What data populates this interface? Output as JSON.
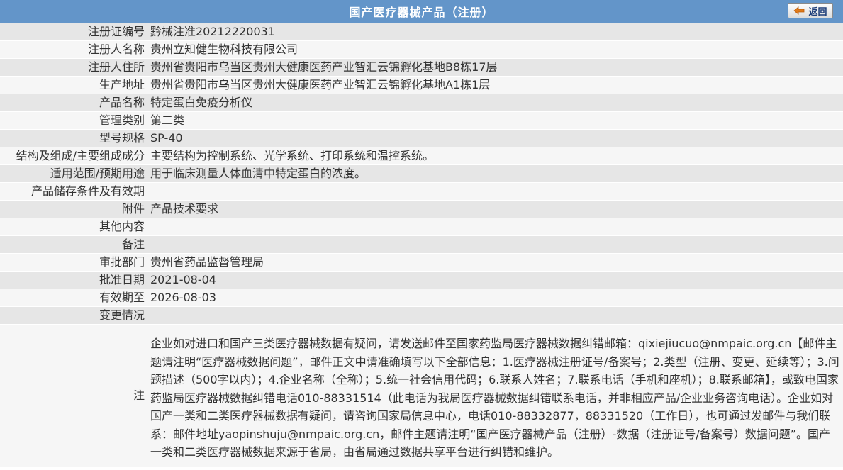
{
  "header": {
    "title": "国产医疗器械产品（注册）",
    "back_label": "返回"
  },
  "rows": [
    {
      "label": "注册证编号",
      "value": "黔械注准20212220031"
    },
    {
      "label": "注册人名称",
      "value": "贵州立知健生物科技有限公司"
    },
    {
      "label": "注册人住所",
      "value": "贵州省贵阳市乌当区贵州大健康医药产业智汇云锦孵化基地B8栋17层"
    },
    {
      "label": "生产地址",
      "value": "贵州省贵阳市乌当区贵州大健康医药产业智汇云锦孵化基地A1栋1层"
    },
    {
      "label": "产品名称",
      "value": "特定蛋白免疫分析仪"
    },
    {
      "label": "管理类别",
      "value": "第二类"
    },
    {
      "label": "型号规格",
      "value": "SP-40"
    },
    {
      "label": "结构及组成/主要组成成分",
      "value": "主要结构为控制系统、光学系统、打印系统和温控系统。"
    },
    {
      "label": "适用范围/预期用途",
      "value": "用于临床测量人体血清中特定蛋白的浓度。"
    },
    {
      "label": "产品储存条件及有效期",
      "value": ""
    },
    {
      "label": "附件",
      "value": "产品技术要求"
    },
    {
      "label": "其他内容",
      "value": ""
    },
    {
      "label": "备注",
      "value": ""
    },
    {
      "label": "审批部门",
      "value": "贵州省药品监督管理局"
    },
    {
      "label": "批准日期",
      "value": "2021-08-04"
    },
    {
      "label": "有效期至",
      "value": "2026-08-03"
    },
    {
      "label": "变更情况",
      "value": ""
    }
  ],
  "note": {
    "label": "注",
    "text": "企业如对进口和国产三类医疗器械数据有疑问，请发送邮件至国家药监局医疗器械数据纠错邮箱：qixiejiucuo@nmpaic.org.cn【邮件主题请注明“医疗器械数据问题”，邮件正文中请准确填写以下全部信息：1.医疗器械注册证号/备案号；2.类型（注册、变更、延续等）；3.问题描述（500字以内）；4.企业名称（全称）；5.统一社会信用代码；6.联系人姓名；7.联系电话（手机和座机）；8.联系邮箱】，或致电国家药监局医疗器械数据纠错电话010-88331514（此电话为我局医疗器械数据纠错联系电话，并非相应产品/企业业务咨询电话）。企业如对国产一类和二类医疗器械数据有疑问，请咨询国家局信息中心，电话010-88332877，88331520（工作日），也可通过发邮件与我们联系：邮件地址yaopinshuju@nmpaic.org.cn，邮件主题请注明“国产医疗器械产品（注册）-数据（注册证号/备案号）数据问题”。国产一类和二类医疗器械数据来源于省局，由省局通过数据共享平台进行纠错和维护。"
  },
  "colors": {
    "header_bg": "#6395c9",
    "row_odd": "#e6e6e6",
    "row_even": "#f6f6f6"
  },
  "icons": {
    "back": "back-arrow-icon"
  }
}
